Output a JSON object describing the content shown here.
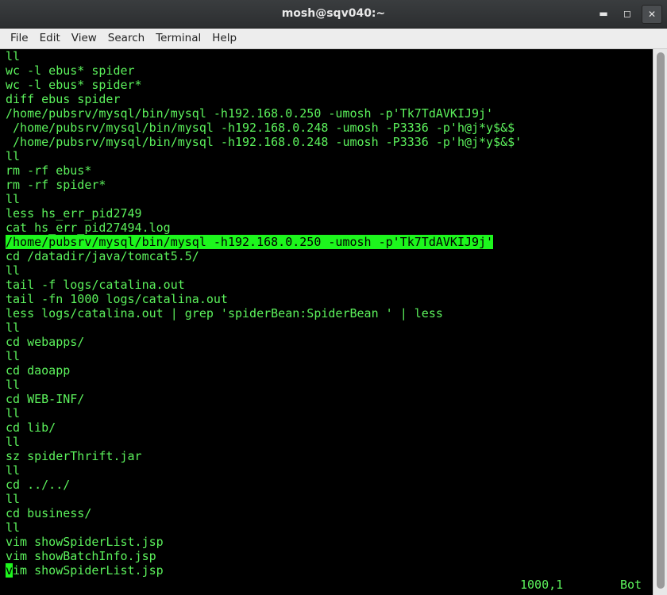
{
  "window": {
    "title": "mosh@sqv040:~"
  },
  "menubar": {
    "items": [
      "File",
      "Edit",
      "View",
      "Search",
      "Terminal",
      "Help"
    ]
  },
  "terminal": {
    "lines": [
      "ll",
      "wc -l ebus* spider",
      "wc -l ebus* spider*",
      "diff ebus spider",
      "/home/pubsrv/mysql/bin/mysql -h192.168.0.250 -umosh -p'Tk7TdAVKIJ9j'",
      " /home/pubsrv/mysql/bin/mysql -h192.168.0.248 -umosh -P3336 -p'h@j*y$&$",
      " /home/pubsrv/mysql/bin/mysql -h192.168.0.248 -umosh -P3336 -p'h@j*y$&$'",
      "ll",
      "rm -rf ebus*",
      "rm -rf spider*",
      "ll",
      "less hs_err_pid2749",
      "cat hs_err_pid27494.log",
      "/home/pubsrv/mysql/bin/mysql -h192.168.0.250 -umosh -p'Tk7TdAVKIJ9j'",
      "cd /datadir/java/tomcat5.5/",
      "ll",
      "tail -f logs/catalina.out",
      "tail -fn 1000 logs/catalina.out",
      "less logs/catalina.out | grep 'spiderBean:SpiderBean ' | less",
      "ll",
      "cd webapps/",
      "ll",
      "cd daoapp",
      "ll",
      "cd WEB-INF/",
      "ll",
      "cd lib/",
      "ll",
      "sz spiderThrift.jar",
      "ll",
      "cd ../../",
      "ll",
      "cd business/",
      "ll",
      "vim showSpiderList.jsp",
      "vim showBatchInfo.jsp"
    ],
    "highlighted_line_index": 13,
    "last_line": {
      "cursor_char": "v",
      "rest": "im showSpiderList.jsp"
    },
    "status": {
      "position": "1000,1",
      "scroll": "Bot"
    },
    "colors": {
      "text": "#5cf25c",
      "highlight": "#1df61d",
      "background": "#000000"
    }
  }
}
